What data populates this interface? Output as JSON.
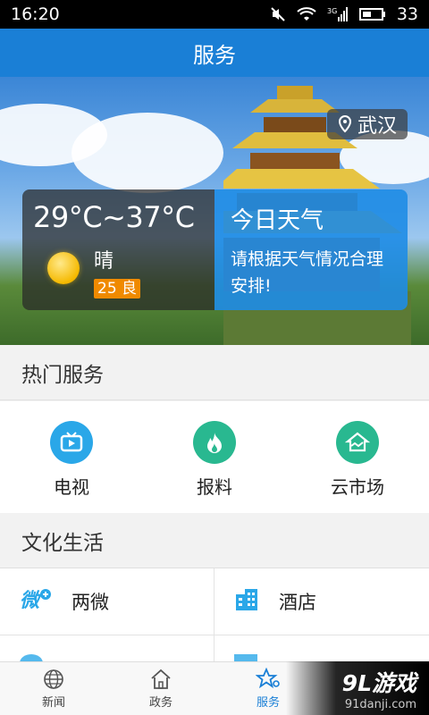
{
  "status": {
    "time": "16:20",
    "network": "3G",
    "battery": "33"
  },
  "appbar": {
    "title": "服务"
  },
  "hero": {
    "location": "武汉",
    "temperature": "29°C~37°C",
    "condition": "晴",
    "aqi": "25 良",
    "card_title": "今日天气",
    "card_desc": "请根据天气情况合理安排!"
  },
  "hot_services": {
    "title": "热门服务",
    "items": [
      {
        "label": "电视",
        "icon": "tv-icon",
        "color": "#2aa7e8"
      },
      {
        "label": "报料",
        "icon": "flame-icon",
        "color": "#29b890"
      },
      {
        "label": "云市场",
        "icon": "market-icon",
        "color": "#29b890"
      }
    ]
  },
  "culture": {
    "title": "文化生活",
    "items": [
      {
        "label": "两微",
        "icon": "weibo-icon"
      },
      {
        "label": "酒店",
        "icon": "hotel-icon"
      }
    ]
  },
  "tabs": [
    {
      "label": "新闻",
      "icon": "globe-icon"
    },
    {
      "label": "政务",
      "icon": "building-icon"
    },
    {
      "label": "服务",
      "icon": "star-icon"
    }
  ],
  "watermark": {
    "brand": "9L游戏",
    "site": "91danji.com"
  },
  "colors": {
    "primary": "#1a7fd6",
    "aqi": "#f08a00"
  }
}
